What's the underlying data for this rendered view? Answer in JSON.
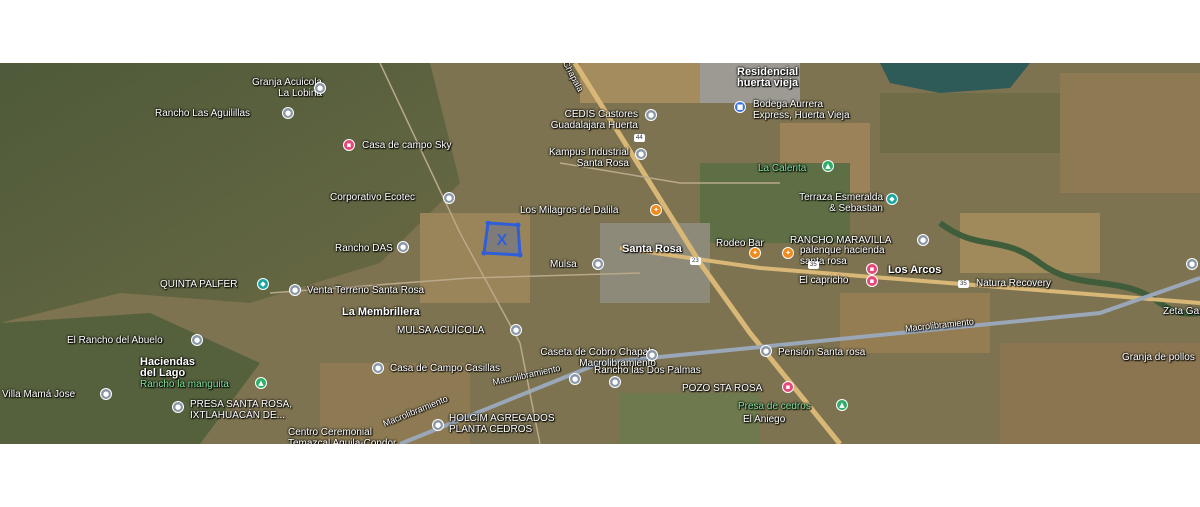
{
  "labels": {
    "granja_acuicola": "Granja Acuicola\nLa Lobina",
    "rancho_las_aguilillas": "Rancho Las Aguilillas",
    "casa_de_campo_sky": "Casa de campo Sky",
    "corporativo_ecotec": "Corporativo Ecotec",
    "rancho_das": "Rancho DAS",
    "quinta_palfer": "QUINTA PALFER",
    "venta_terreno": "Venta Terreno Santa Rosa",
    "la_membrillera": "La Membrillera",
    "mulsa_acuicola": "MULSA ACUÍCOLA",
    "el_rancho_del_abuelo": "El Rancho del Abuelo",
    "haciendas_del_lago": "Haciendas\ndel Lago",
    "rancho_la_manguita": "Rancho la manguita",
    "villa_mama_jose": "Villa Mamá Jose",
    "presa_santa_rosa": "PRESA SANTA ROSA,\nIXTLAHUACÁN DE...",
    "casa_de_campo_casillas": "Casa de Campo Casillas",
    "centro_ceremonial": "Centro Ceremonial\nTemazcal Aguila-Condor",
    "holcim": "HOLCIM AGREGADOS\nPLANTA CEDROS",
    "macrolibramiento_1": "Macrolibramiento",
    "macrolibramiento_2": "Macrolibramiento",
    "macrolibramiento_3": "Macrolibramiento",
    "caseta_de_cobro": "Caseta de Cobro Chapala\nMacrolibramiento",
    "rancho_las_dos_palmas": "Rancho las Dos Palmas",
    "pozo_sta_rosa": "POZO STA ROSA",
    "presa_de_cedros": "Presa de cedros",
    "el_aniego": "El Aniego",
    "pension_santa_rosa": "Pensión Santa rosa",
    "mulsa": "Mulsa",
    "santa_rosa": "Santa Rosa",
    "los_milagros": "Los Milagros de Dalila",
    "kampus_industrial": "Kampus Industrial\nSanta Rosa",
    "cedis_castores": "CEDIS Castores\nGuadalajara Huerta",
    "residencial_huerta_vieja": "Residencial\nhuerta vieja",
    "bodega_aurrera": "Bodega Aurrera\nExpress, Huerta Vieja",
    "la_calerita": "La Calerita",
    "terraza_esmeralda": "Terraza Esmeralda\n& Sebastian",
    "rodeo_bar": "Rodeo Bar",
    "rancho_maravilla": "RANCHO MARAVILLA",
    "palenque": "palenque hacienda\nsanta rosa",
    "los_arcos": "Los Arcos",
    "el_capricho": "El capricho",
    "natura_recovery": "Natura Recovery",
    "zeta_ga": "Zeta Ga",
    "granja_de_pollos": "Granja de pollos",
    "chapala_road": "Chapala"
  },
  "shields": {
    "s44": "44",
    "s23": "23",
    "s35a": "35",
    "s35b": "35"
  },
  "icons": {
    "gray": "place-pin-icon",
    "pink": "lodging-pin-icon",
    "orange": "food-pin-icon",
    "green": "park-pin-icon",
    "teal": "venue-pin-icon",
    "blue": "shopping-pin-icon"
  },
  "colors": {
    "highway": "#d9b777",
    "macrolibramiento": "#9aa7b8",
    "marker": "#2f5fd8",
    "pin_gray": "#8a97a6",
    "pin_pink": "#e5487a",
    "pin_orange": "#f08a1c",
    "pin_green": "#2fae6a"
  }
}
